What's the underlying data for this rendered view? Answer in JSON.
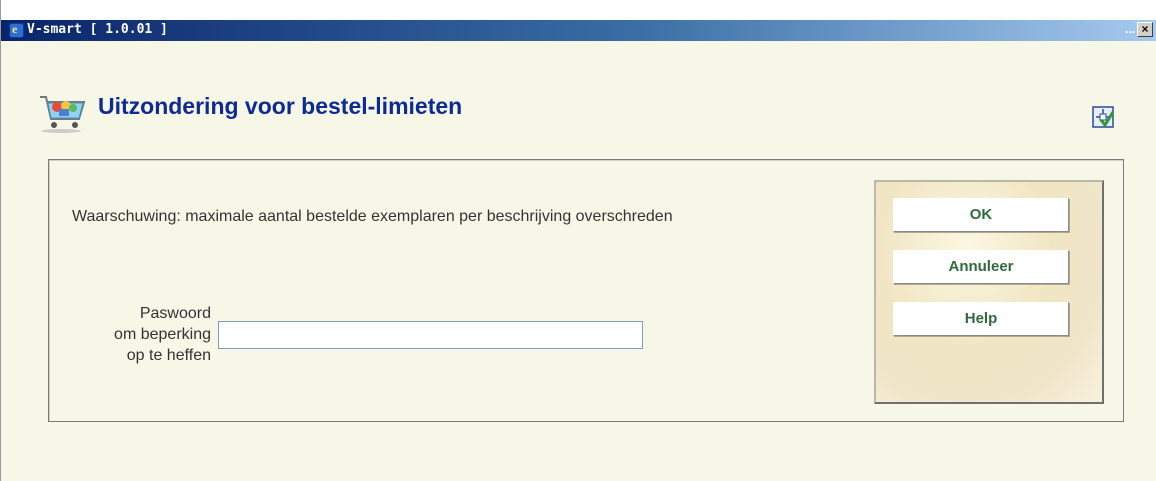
{
  "window": {
    "title": "V-smart [ 1.0.01 ]",
    "dots": "...",
    "close_glyph": "×",
    "app_icon": "ie-logo-icon",
    "app_icon_glyph": "e"
  },
  "header": {
    "title": "Uitzondering voor bestel-limieten",
    "icon": "shopping-cart-icon",
    "config_icon": "settings-check-icon"
  },
  "form": {
    "warning": "Waarschuwing: maximale aantal bestelde exemplaren per beschrijving overschreden",
    "password_label_1": "Paswoord",
    "password_label_2": "om beperking",
    "password_label_3": "op te heffen",
    "password_value": ""
  },
  "buttons": {
    "ok": "OK",
    "cancel": "Annuleer",
    "help": "Help"
  },
  "colors": {
    "title": "#0e2a94",
    "button_text": "#2f6b3a",
    "background": "#f7f7e7"
  }
}
